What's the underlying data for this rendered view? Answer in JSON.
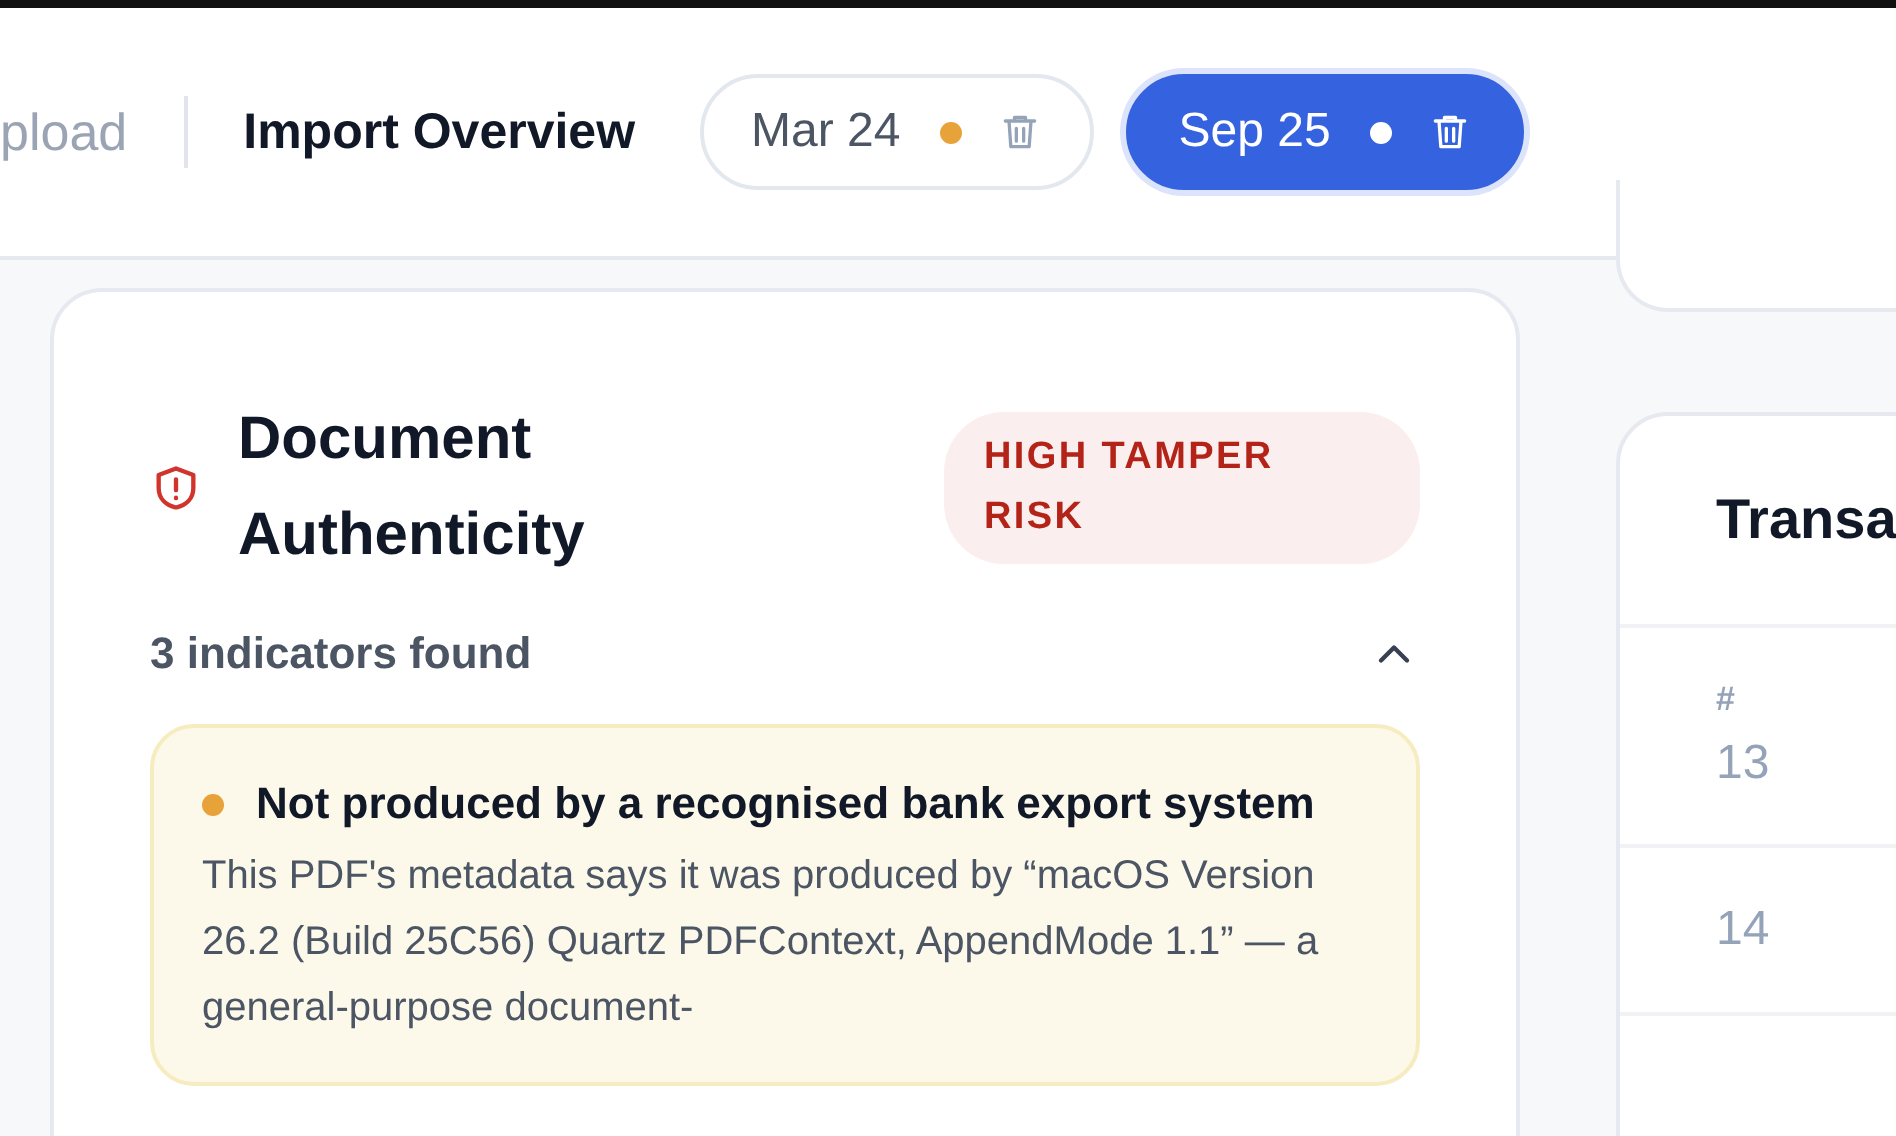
{
  "header": {
    "breadcrumbs": [
      {
        "label": "pload",
        "selected": false
      },
      {
        "label": "Import Overview",
        "selected": true
      }
    ],
    "periods": [
      {
        "label": "Mar 24",
        "color": "#e8a23a",
        "selected": false
      },
      {
        "label": "Sep 25",
        "color": "#ffffff",
        "selected": true
      }
    ]
  },
  "authenticity": {
    "title": "Document Authenticity",
    "badge": "HIGH TAMPER RISK",
    "summary": "3 indicators found",
    "expanded": true,
    "indicators": [
      {
        "title": "Not produced by a recognised bank export system",
        "color": "#e8a23a",
        "text": "This PDF's metadata says it was produced by “macOS Version 26.2 (Build 25C56) Quartz PDFContext, AppendMode 1.1” — a general-purpose document-"
      }
    ]
  },
  "transactions": {
    "title": "Transa",
    "columns": [
      "#"
    ],
    "rows": [
      [
        "13"
      ],
      [
        "14"
      ]
    ]
  }
}
